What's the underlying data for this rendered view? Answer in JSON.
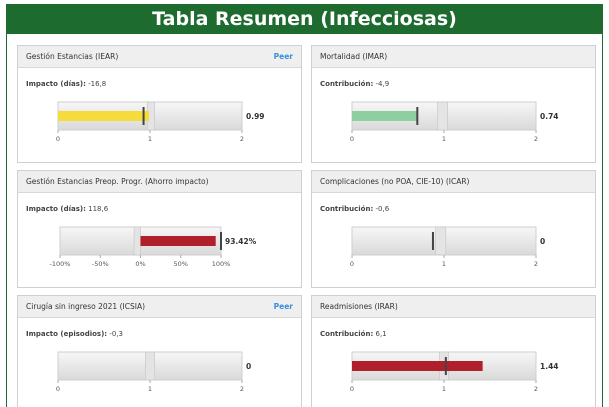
{
  "title": "Tabla Resumen (Infecciosas)",
  "colors": {
    "banner": "#1e6b30",
    "yellow": "#f5dc3c",
    "green": "#8ecfa0",
    "red": "#b0202a",
    "peer": "#3a8edc"
  },
  "panels": [
    {
      "title": "Gestión Estancias (IEAR)",
      "peer": "Peer",
      "metric_label": "Impacto (días):",
      "metric_value": "-16,8",
      "axis": {
        "min": 0,
        "max": 2,
        "ticks": [
          "0",
          "1",
          "2"
        ],
        "tick_values": [
          0,
          1,
          2
        ]
      },
      "bands": [
        {
          "from": 0.97,
          "to": 1.05
        }
      ],
      "bar": {
        "value": 0.99,
        "color": "yellow"
      },
      "marker": 0.93,
      "value_label": "0.99"
    },
    {
      "title": "Mortalidad (IMAR)",
      "peer": "",
      "metric_label": "Contribución:",
      "metric_value": "-4,9",
      "axis": {
        "min": 0,
        "max": 2,
        "ticks": [
          "0",
          "1",
          "2"
        ],
        "tick_values": [
          0,
          1,
          2
        ]
      },
      "bands": [
        {
          "from": 0.93,
          "to": 1.04
        }
      ],
      "bar": {
        "value": 0.71,
        "color": "green"
      },
      "marker": 0.71,
      "value_label": "0.74"
    },
    {
      "title": "Gestión Estancias Preop. Progr. (Ahorro impacto)",
      "peer": "",
      "metric_label": "Impacto (días):",
      "metric_value": "118,6",
      "axis": {
        "min": -100,
        "max": 100,
        "ticks": [
          "-100%",
          "-50%",
          "0%",
          "50%",
          "100%"
        ],
        "tick_values": [
          -100,
          -50,
          0,
          50,
          100
        ]
      },
      "bands": [
        {
          "from": -8,
          "to": 0
        }
      ],
      "bar": {
        "value": 93.42,
        "from": 0,
        "color": "red"
      },
      "marker": 100,
      "value_label": "93.42%"
    },
    {
      "title": "Complicaciones (no POA, CIE-10) (ICAR)",
      "peer": "",
      "metric_label": "Contribución:",
      "metric_value": "-0,6",
      "axis": {
        "min": 0,
        "max": 2,
        "ticks": [
          "0",
          "1",
          "2"
        ],
        "tick_values": [
          0,
          1,
          2
        ]
      },
      "bands": [
        {
          "from": 0.91,
          "to": 1.02
        }
      ],
      "bar": null,
      "marker": 0.88,
      "value_label": "0"
    },
    {
      "title": "Cirugía sin ingreso 2021 (ICSIA)",
      "peer": "Peer",
      "metric_label": "Impacto (episodios):",
      "metric_value": "-0,3",
      "axis": {
        "min": 0,
        "max": 2,
        "ticks": [
          "0",
          "1",
          "2"
        ],
        "tick_values": [
          0,
          1,
          2
        ]
      },
      "bands": [
        {
          "from": 0.95,
          "to": 1.05
        }
      ],
      "bar": null,
      "marker": null,
      "value_label": "0"
    },
    {
      "title": "Readmisiones (IRAR)",
      "peer": "",
      "metric_label": "Contribución:",
      "metric_value": "6,1",
      "axis": {
        "min": 0,
        "max": 2,
        "ticks": [
          "0",
          "1",
          "2"
        ],
        "tick_values": [
          0,
          1,
          2
        ]
      },
      "bands": [
        {
          "from": 0.95,
          "to": 1.05
        }
      ],
      "bar": {
        "value": 1.42,
        "color": "red"
      },
      "marker": 1.02,
      "value_label": "1.44"
    }
  ]
}
